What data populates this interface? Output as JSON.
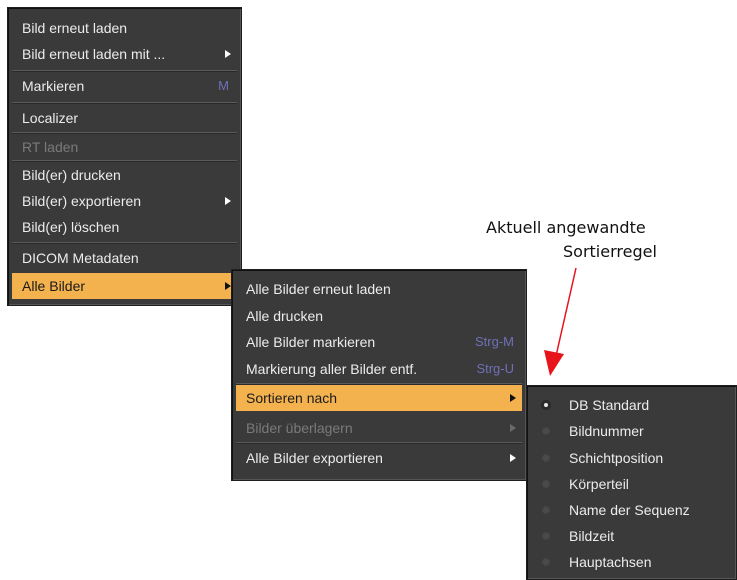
{
  "menu1": {
    "items": [
      {
        "label": "Bild erneut laden"
      },
      {
        "label": "Bild erneut laden mit ..."
      },
      {
        "label": "Markieren",
        "shortcut": "M"
      },
      {
        "label": "Localizer"
      },
      {
        "label": "RT laden"
      },
      {
        "label": "Bild(er) drucken"
      },
      {
        "label": "Bild(er) exportieren"
      },
      {
        "label": "Bild(er) löschen"
      },
      {
        "label": "DICOM Metadaten"
      },
      {
        "label": "Alle Bilder"
      }
    ]
  },
  "menu2": {
    "items": [
      {
        "label": "Alle Bilder erneut laden"
      },
      {
        "label": "Alle drucken"
      },
      {
        "label": "Alle Bilder markieren",
        "shortcut": "Strg-M"
      },
      {
        "label": "Markierung aller Bilder entf.",
        "shortcut": "Strg-U"
      },
      {
        "label": "Sortieren nach"
      },
      {
        "label": "Bilder überlagern"
      },
      {
        "label": "Alle Bilder exportieren"
      }
    ]
  },
  "menu3": {
    "items": [
      {
        "label": "DB Standard",
        "selected": true
      },
      {
        "label": "Bildnummer",
        "selected": false
      },
      {
        "label": "Schichtposition",
        "selected": false
      },
      {
        "label": "Körperteil",
        "selected": false
      },
      {
        "label": "Name der Sequenz",
        "selected": false
      },
      {
        "label": "Bildzeit",
        "selected": false
      },
      {
        "label": "Hauptachsen",
        "selected": false
      }
    ]
  },
  "annotation": {
    "line1": "Aktuell angewandte",
    "line2": "Sortierregel",
    "arrow_color": "#e8141c"
  },
  "colors": {
    "menu_bg": "#3a3a3a",
    "highlight": "#f3b24e",
    "shortcut": "#7070b8"
  }
}
